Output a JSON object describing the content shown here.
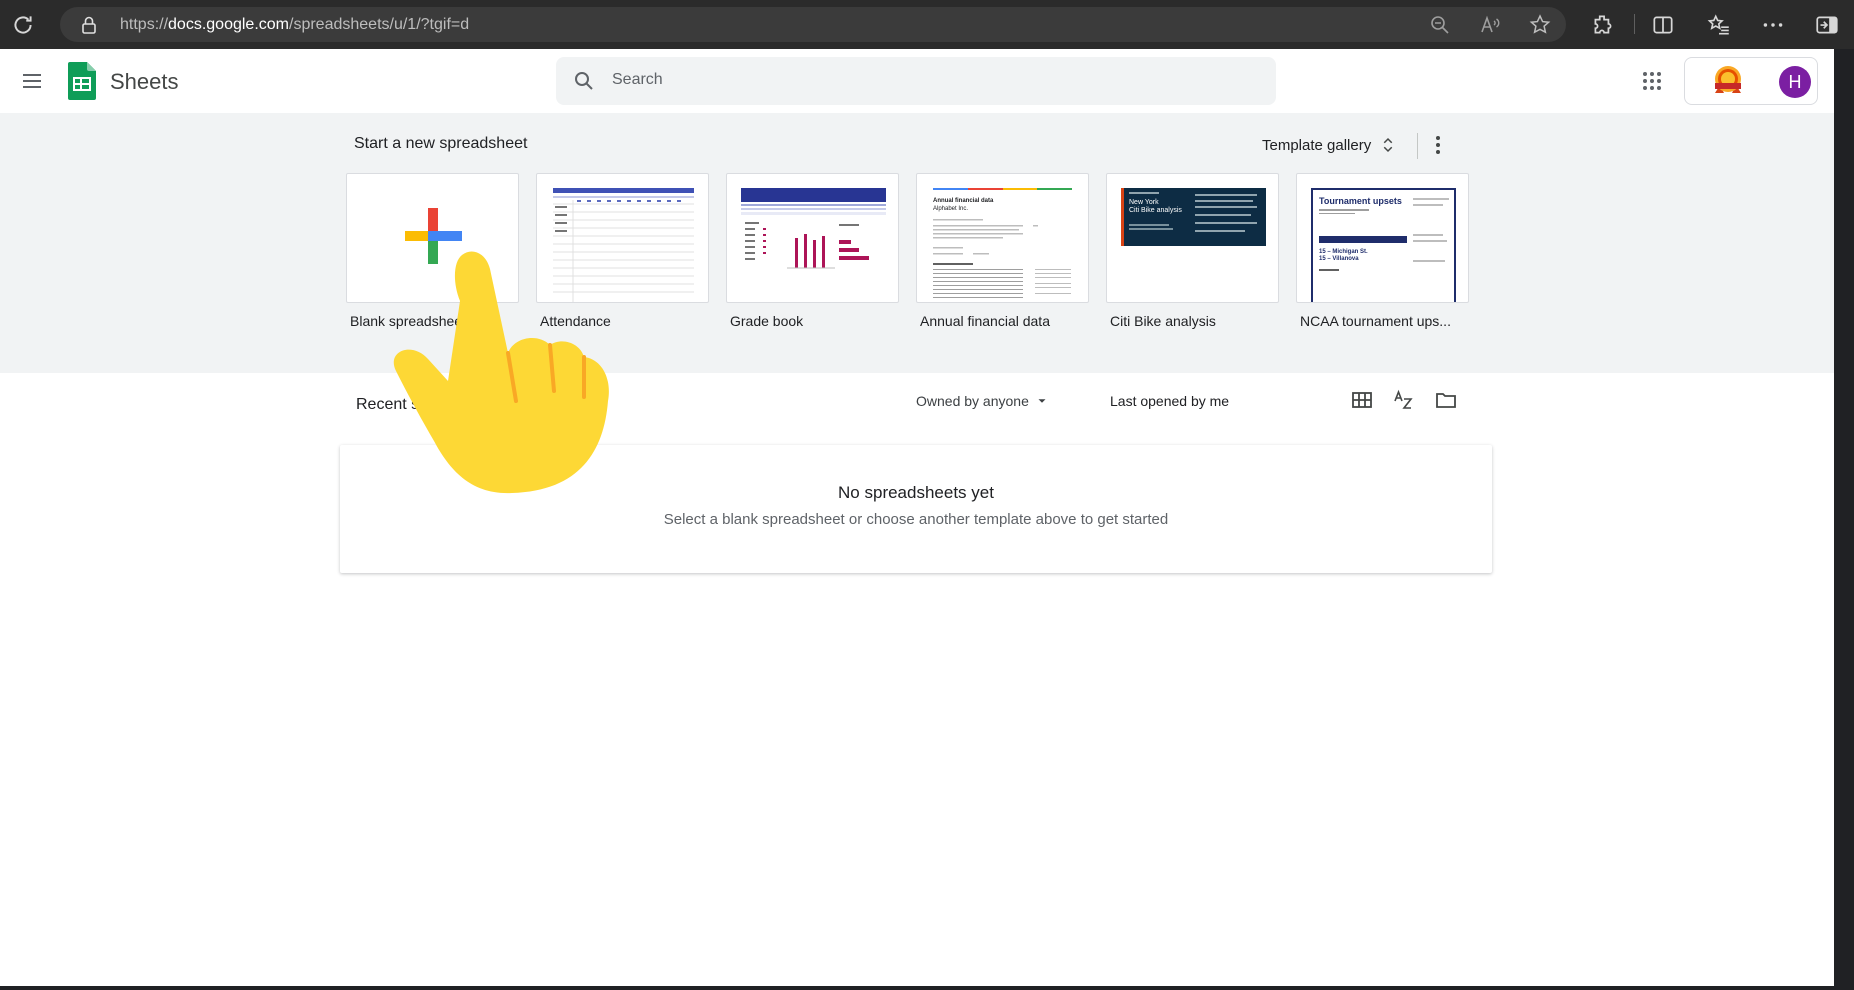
{
  "browser": {
    "url_prefix": "https://",
    "url_host": "docs.google.com",
    "url_path": "/spreadsheets/u/1/?tgif=d"
  },
  "header": {
    "app_name": "Sheets",
    "search_placeholder": "Search",
    "avatar_letter": "H"
  },
  "templates": {
    "section_title": "Start a new spreadsheet",
    "gallery_label": "Template gallery",
    "items": [
      {
        "label": "Blank spreadsheet"
      },
      {
        "label": "Attendance"
      },
      {
        "label": "Grade book"
      },
      {
        "label": "Annual financial data"
      },
      {
        "label": "Citi Bike analysis"
      },
      {
        "label": "NCAA tournament ups..."
      }
    ],
    "thumb_text": {
      "financial_title": "Annual financial data",
      "financial_sub": "Alphabet Inc.",
      "citibike_title_1": "New York",
      "citibike_title_2": "Citi Bike analysis",
      "ncaa_title": "Tournament upsets",
      "ncaa_line1": "15 – Michigan St.",
      "ncaa_line2": "15 – Villanova"
    }
  },
  "recent": {
    "title": "Recent spreadsheets",
    "owner_filter": "Owned by anyone",
    "sort_label": "Last opened by me",
    "empty_title": "No spreadsheets yet",
    "empty_subtitle": "Select a blank spreadsheet or choose another template above to get started"
  },
  "colors": {
    "sheets_green": "#0f9d58",
    "brand_navy": "#1f2d6b",
    "avatar_purple": "#7b1fa2",
    "hand_yellow": "#fdd835"
  }
}
